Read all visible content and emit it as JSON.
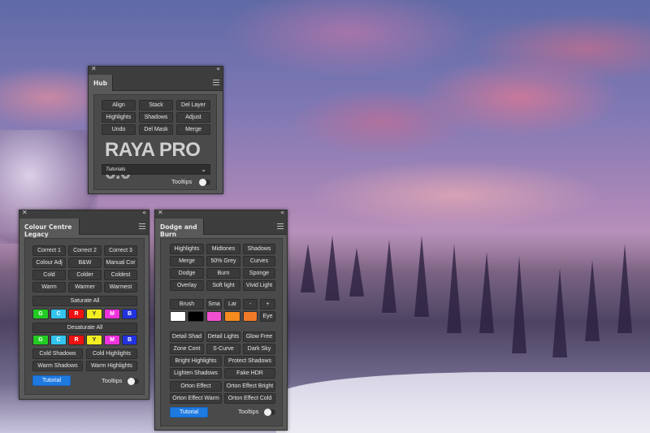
{
  "hub": {
    "tab": "Hub",
    "buttons": [
      "Align",
      "Stack",
      "Del Layer",
      "Highlights",
      "Shadows",
      "Adjust",
      "Undo",
      "Del Mask",
      "Merge"
    ],
    "logo": "RAYA PRO",
    "version": "6.0",
    "dropdown_value": "Tutorials",
    "tooltips_label": "Tooltips"
  },
  "colour_centre": {
    "tab": "Colour Centre Legacy",
    "buttons": [
      "Correct 1",
      "Correct 2",
      "Correct 3",
      "Colour Adj",
      "B&W",
      "Manual Cor",
      "Cold",
      "Colder",
      "Coldest",
      "Warm",
      "Warmer",
      "Warmest"
    ],
    "saturate_all": "Saturate All",
    "desaturate_all": "Desaturate All",
    "channels": [
      {
        "label": "G",
        "color": "#22cc22",
        "text": "#ffffff"
      },
      {
        "label": "C",
        "color": "#33c4ee",
        "text": "#ffffff"
      },
      {
        "label": "R",
        "color": "#ee1111",
        "text": "#ffffff"
      },
      {
        "label": "Y",
        "color": "#f2ee22",
        "text": "#333333"
      },
      {
        "label": "M",
        "color": "#ee33dd",
        "text": "#ffffff"
      },
      {
        "label": "B",
        "color": "#2233dd",
        "text": "#ffffff"
      }
    ],
    "bottom_buttons": [
      "Cold Shadows",
      "Cold Highlights",
      "Warm Shadows",
      "Warm Highlights"
    ],
    "tutorial": "Tutorial",
    "tooltips_label": "Tooltips"
  },
  "dodge_burn": {
    "tab": "Dodge and Burn",
    "buttons": [
      "Highlights",
      "Midtones",
      "Shadows",
      "Merge",
      "50% Grey",
      "Curves",
      "Dodge",
      "Burn",
      "Sponge",
      "Overlay",
      "Soft light",
      "Vivid Light"
    ],
    "brush_row": [
      "Brush",
      "Sma",
      "Lar",
      "-",
      "+"
    ],
    "swatches": [
      "#ffffff",
      "#000000",
      "#f050d0",
      "#f58a1e",
      "#f07a28"
    ],
    "eye": "Eye",
    "lower_buttons": [
      "Detail Shad",
      "Detail Lights",
      "Glow Free",
      "Zone Cont",
      "S-Curve",
      "Dark Sky"
    ],
    "wide_buttons": [
      "Bright Highlights",
      "Protect Shadows",
      "Lighten Shadows",
      "Fake HDR",
      "Orton Effect",
      "Orton Effect Bright",
      "Orton Effect Warm",
      "Orton Effect Cold"
    ],
    "tutorial": "Tutorial",
    "tooltips_label": "Tooltips"
  }
}
